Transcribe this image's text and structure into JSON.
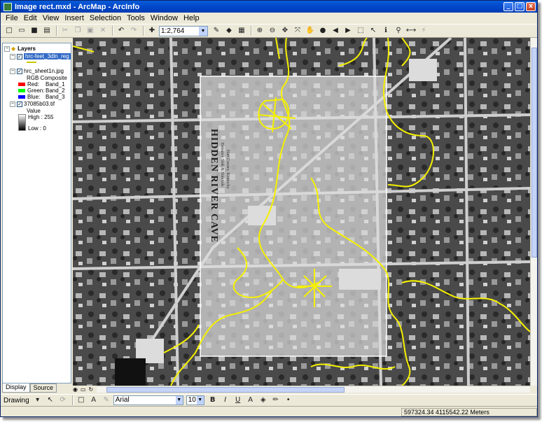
{
  "window": {
    "title": "Image rect.mxd - ArcMap - ArcInfo",
    "minimize": "_",
    "maximize": "□",
    "close": "x"
  },
  "menu": [
    "File",
    "Edit",
    "View",
    "Insert",
    "Selection",
    "Tools",
    "Window",
    "Help"
  ],
  "toolbar": {
    "scale": "1:2,764"
  },
  "toc": {
    "root": "Layers",
    "layers": [
      {
        "name": "hrc-feet_3dln_reg",
        "checked": true,
        "selected": true
      },
      {
        "name": "hrc_sheet1n.jpg",
        "checked": true,
        "composite": "RGB Composite",
        "bands": [
          {
            "label": "Red:",
            "band": "Band_1",
            "color": "#ff0000"
          },
          {
            "label": "Green:",
            "band": "Band_2",
            "color": "#00ff00"
          },
          {
            "label": "Blue:",
            "band": "Band_3",
            "color": "#0000ff"
          }
        ]
      },
      {
        "name": "37085b03.tif",
        "checked": true,
        "value_label": "Value",
        "high": "High : 255",
        "low": "Low : 0"
      }
    ],
    "tabs": [
      "Display",
      "Source"
    ]
  },
  "map": {
    "sheet_title": "HIDDEN RIVER CAVE",
    "sheet_lines": [
      "Entrance Sink & Sinkhole",
      "Hart County, Kentucky"
    ],
    "cave_color": "#f5f000"
  },
  "drawing": {
    "label": "Drawing",
    "font": "Arial",
    "size": "10",
    "bold": "B",
    "italic": "I",
    "underline": "U"
  },
  "status": {
    "coordinates": "597324.34  4115542.22 Meters"
  }
}
